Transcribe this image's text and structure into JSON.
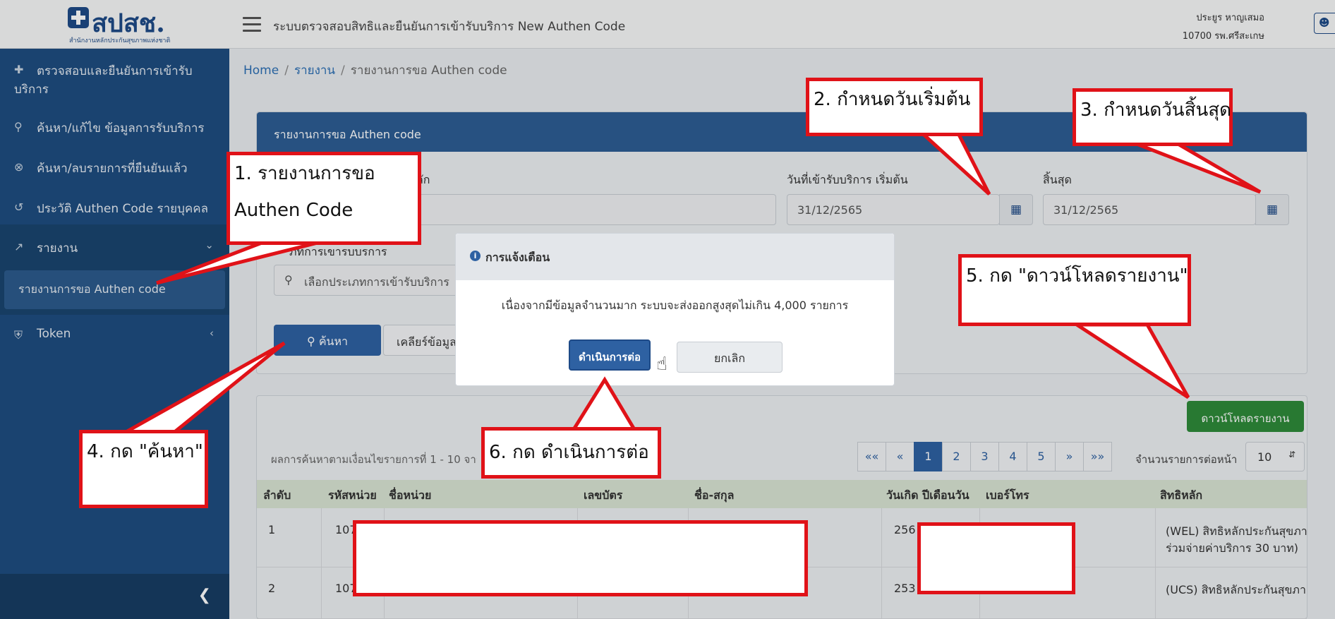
{
  "header": {
    "logo_text": "สปสช.",
    "logo_sub": "สำนักงานหลักประกันสุขภาพแห่งชาติ",
    "app_title": "ระบบตรวจสอบสิทธิและยืนยันการเข้ารับบริการ New Authen Code",
    "user_name": "ประยูร หาญเสมอ",
    "user_unit": "10700 รพ.ศรีสะเกษ",
    "user_menu_icon": "user-icon"
  },
  "sidebar": {
    "items": [
      {
        "icon": "plus-icon",
        "label_line1": "ตรวจสอบและยืนยันการเข้ารับ",
        "label_line2": "บริการ"
      },
      {
        "icon": "search-icon",
        "label": "ค้นหา/แก้ไข ข้อมูลการรับบริการ"
      },
      {
        "icon": "cancel-circle-icon",
        "label": "ค้นหา/ลบรายการที่ยืนยันแล้ว"
      },
      {
        "icon": "history-icon",
        "label": "ประวัติ Authen Code รายบุคคล"
      },
      {
        "icon": "chart-icon",
        "label": "รายงาน"
      },
      {
        "icon": "shield-icon",
        "label": "Token"
      }
    ],
    "sub_item": "รายงานการขอ Authen code"
  },
  "breadcrumb": {
    "home": "Home",
    "report": "รายงาน",
    "current": "รายงานการขอ Authen code"
  },
  "card": {
    "title": "รายงานการขอ Authen code",
    "main_right_label": "ลัก",
    "start_date_label": "วันที่เข้ารับบริการ เริ่มต้น",
    "start_date_value": "31/12/2565",
    "end_date_label": "สิ้นสุด",
    "end_date_value": "31/12/2565",
    "service_type_label": "ภทการเขารบบรการ",
    "service_type_placeholder": "เลือกประเภทการเข้ารับบริการ",
    "search_button": "ค้นหา",
    "clear_button": "เคลียร์ข้อมูล"
  },
  "results": {
    "download_button": "ดาวน์โหลดรายงาน",
    "result_text": "ผลการค้นหาตามเงื่อนไขรายการที่ 1 - 10 จาก",
    "pager": [
      "««",
      "«",
      "1",
      "2",
      "3",
      "4",
      "5",
      "»",
      "»»"
    ],
    "per_page_label": "จำนวนรายการต่อหน้า",
    "per_page_value": "10",
    "columns": [
      "ลำดับ",
      "รหัสหน่วย",
      "ชื่อหน่วย",
      "เลขบัตร",
      "ชื่อ-สกุล",
      "วันเกิด ปีเดือนวัน",
      "เบอร์โทร",
      "สิทธิหลัก"
    ],
    "rows": [
      {
        "no": "1",
        "code": "107",
        "birth": "256",
        "right": "(WEL) สิทธิหลักประกันสุขภา",
        "right2": "ร่วมจ่ายค่าบริการ 30 บาท)"
      },
      {
        "no": "2",
        "code": "107",
        "birth": "253",
        "right": "(UCS) สิทธิหลักประกันสุขภา",
        "right2": ""
      }
    ]
  },
  "modal": {
    "title": "การแจ้งเตือน",
    "message": "เนื่องจากมีข้อมูลจำนวนมาก ระบบจะส่งออกสูงสุดไม่เกิน 4,000 รายการ",
    "continue_button": "ดำเนินการต่อ",
    "cancel_button": "ยกเลิก"
  },
  "annotations": {
    "step1_line1": "1. รายงานการขอ",
    "step1_line2": "Authen Code",
    "step2": "2. กำหนดวันเริ่มต้น",
    "step3": "3. กำหนดวันสิ้นสุด",
    "step4": "4. กด \"ค้นหา\"",
    "step5": "5. กด \"ดาวน์โหลดรายงาน\"",
    "step6": "6. กด ดำเนินการต่อ"
  },
  "colors": {
    "sidebar": "#1e4d80",
    "primary": "#2e61a2",
    "success": "#2e8a3a",
    "annotation_border": "#e01218"
  }
}
